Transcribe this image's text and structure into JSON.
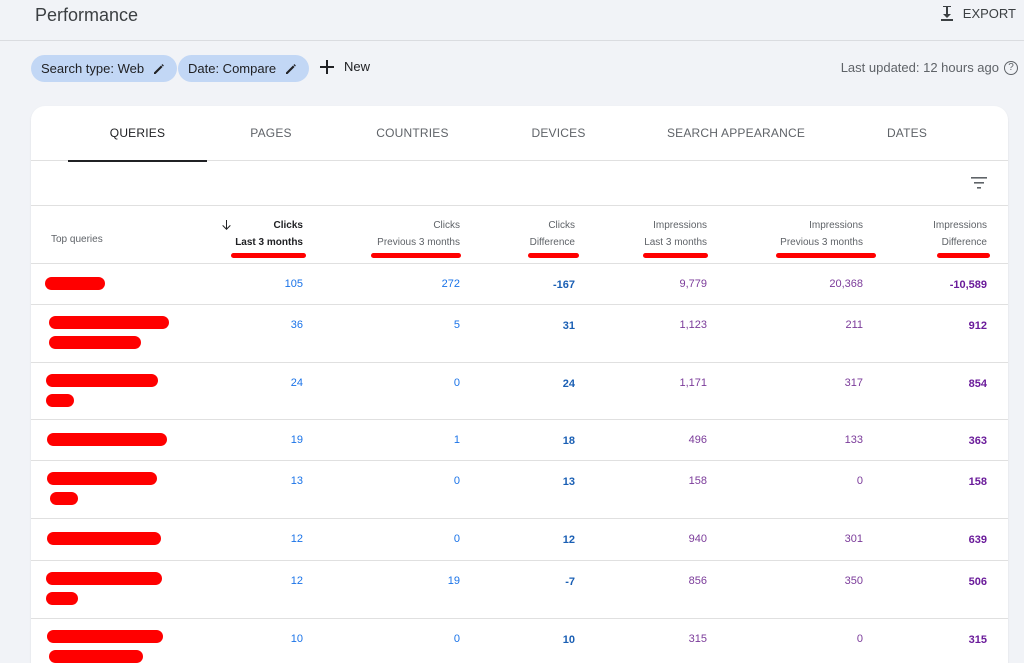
{
  "header": {
    "title": "Performance",
    "export_label": "EXPORT"
  },
  "filters": {
    "chips": [
      {
        "label": "Search type: Web",
        "icon": "pencil-icon"
      },
      {
        "label": "Date: Compare",
        "icon": "pencil-icon"
      }
    ],
    "new_label": "New",
    "last_updated": "Last updated: 12 hours ago",
    "help_glyph": "?"
  },
  "tabs": [
    {
      "label": "QUERIES",
      "active": true
    },
    {
      "label": "PAGES",
      "active": false
    },
    {
      "label": "COUNTRIES",
      "active": false
    },
    {
      "label": "DEVICES",
      "active": false
    },
    {
      "label": "SEARCH APPEARANCE",
      "active": false
    },
    {
      "label": "DATES",
      "active": false
    }
  ],
  "table": {
    "first_col_header": "Top queries",
    "columns": [
      {
        "metric": "Clicks",
        "period": "Last 3 months",
        "sorted": true
      },
      {
        "metric": "Clicks",
        "period": "Previous 3 months"
      },
      {
        "metric": "Clicks",
        "period": "Difference"
      },
      {
        "metric": "Impressions",
        "period": "Last 3 months"
      },
      {
        "metric": "Impressions",
        "period": "Previous 3 months"
      },
      {
        "metric": "Impressions",
        "period": "Difference"
      }
    ],
    "rows": [
      {
        "clicks_last": "105",
        "clicks_prev": "272",
        "clicks_diff": "-167",
        "impr_last": "9,779",
        "impr_prev": "20,368",
        "impr_diff": "-10,589"
      },
      {
        "clicks_last": "36",
        "clicks_prev": "5",
        "clicks_diff": "31",
        "impr_last": "1,123",
        "impr_prev": "211",
        "impr_diff": "912"
      },
      {
        "clicks_last": "24",
        "clicks_prev": "0",
        "clicks_diff": "24",
        "impr_last": "1,171",
        "impr_prev": "317",
        "impr_diff": "854"
      },
      {
        "clicks_last": "19",
        "clicks_prev": "1",
        "clicks_diff": "18",
        "impr_last": "496",
        "impr_prev": "133",
        "impr_diff": "363"
      },
      {
        "clicks_last": "13",
        "clicks_prev": "0",
        "clicks_diff": "13",
        "impr_last": "158",
        "impr_prev": "0",
        "impr_diff": "158"
      },
      {
        "clicks_last": "12",
        "clicks_prev": "0",
        "clicks_diff": "12",
        "impr_last": "940",
        "impr_prev": "301",
        "impr_diff": "639"
      },
      {
        "clicks_last": "12",
        "clicks_prev": "19",
        "clicks_diff": "-7",
        "impr_last": "856",
        "impr_prev": "350",
        "impr_diff": "506"
      },
      {
        "clicks_last": "10",
        "clicks_prev": "0",
        "clicks_diff": "10",
        "impr_last": "315",
        "impr_prev": "0",
        "impr_diff": "315"
      }
    ]
  },
  "colors": {
    "clicks": "#1a73e8",
    "impressions": "#7b3b9a",
    "annotation": "#ff0000",
    "chip_bg": "#c2d7f5"
  }
}
